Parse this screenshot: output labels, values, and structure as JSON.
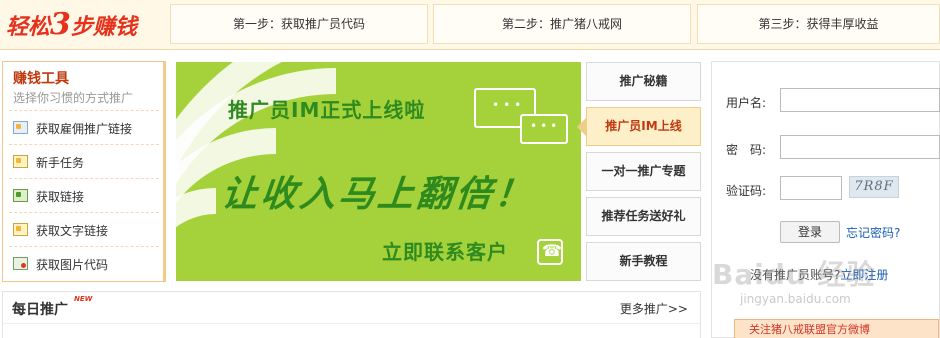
{
  "header": {
    "brand_part1": "轻松",
    "brand_number": "3",
    "brand_part2": "步赚钱",
    "steps": [
      "第一步：获取推广员代码",
      "第二步：推广猪八戒网",
      "第三步：获得丰厚收益"
    ]
  },
  "tools": {
    "title": "赚钱工具",
    "subtitle": "选择你习惯的方式推广",
    "items": [
      {
        "label": "获取雇佣推广链接",
        "icon": "link-page-icon"
      },
      {
        "label": "新手任务",
        "icon": "star-task-icon"
      },
      {
        "label": "获取链接",
        "icon": "green-link-icon"
      },
      {
        "label": "获取文字链接",
        "icon": "text-link-icon"
      },
      {
        "label": "获取图片代码",
        "icon": "image-code-icon"
      }
    ]
  },
  "banner": {
    "headline": "推广员IM正式上线啦",
    "big_text": "让收入马上翻倍！",
    "contact": "立即联系客户",
    "background_color": "#a5d23b",
    "text_color": "#2f8a1f"
  },
  "tabs": [
    {
      "label": "推广秘籍",
      "active": false
    },
    {
      "label": "推广员IM上线",
      "active": true
    },
    {
      "label": "一对一推广专题",
      "active": false
    },
    {
      "label": "推荐任务送好礼",
      "active": false
    },
    {
      "label": "新手教程",
      "active": false
    }
  ],
  "login": {
    "username_label": "用户名:",
    "password_label": "密　码:",
    "captcha_label": "验证码:",
    "captcha_text": "7R8F",
    "login_button": "登录",
    "forgot_link": "忘记密码?",
    "register_prefix": "没有推广员账号?",
    "register_link": "立即注册",
    "promo_strip": "关注猪八戒联盟官方微博"
  },
  "daily": {
    "title": "每日推广",
    "badge": "NEW",
    "more": "更多推广>>"
  },
  "watermark": {
    "main": "Baidu 经验",
    "sub": "jingyan.baidu.com"
  },
  "colors": {
    "brand_red": "#e5321d",
    "accent_orange": "#c0390f",
    "link_blue": "#1a5fb4"
  }
}
